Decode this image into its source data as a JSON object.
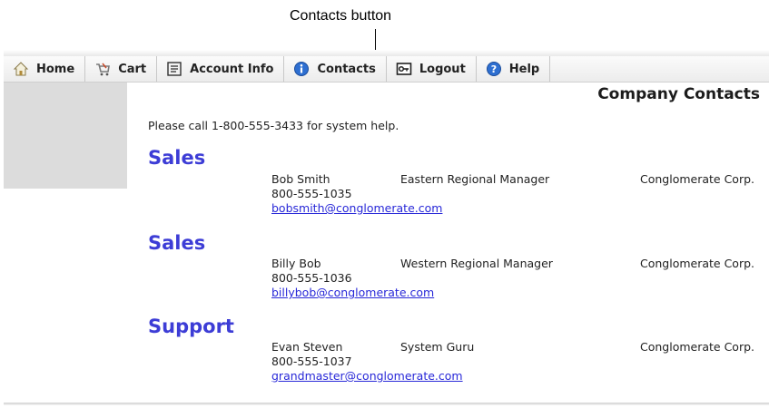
{
  "callout": {
    "text": "Contacts button"
  },
  "nav": {
    "items": [
      {
        "label": "Home",
        "icon": "home-icon"
      },
      {
        "label": "Cart",
        "icon": "cart-icon"
      },
      {
        "label": "Account Info",
        "icon": "account-info-icon"
      },
      {
        "label": "Contacts",
        "icon": "info-icon"
      },
      {
        "label": "Logout",
        "icon": "logout-icon"
      },
      {
        "label": "Help",
        "icon": "help-icon"
      }
    ]
  },
  "page": {
    "title": "Company Contacts",
    "help_text": "Please call 1-800-555-3433 for system help."
  },
  "sections": [
    {
      "heading": "Sales",
      "name": "Bob Smith",
      "role": "Eastern Regional Manager",
      "company": "Conglomerate Corp.",
      "phone": "800-555-1035",
      "email": "bobsmith@conglomerate.com"
    },
    {
      "heading": "Sales",
      "name": "Billy Bob",
      "role": "Western Regional Manager",
      "company": "Conglomerate Corp.",
      "phone": "800-555-1036",
      "email": "billybob@conglomerate.com"
    },
    {
      "heading": "Support",
      "name": "Evan Steven",
      "role": "System Guru",
      "company": "Conglomerate Corp.",
      "phone": "800-555-1037",
      "email": "grandmaster@conglomerate.com"
    }
  ],
  "colors": {
    "accent_heading": "#3d3dd6",
    "link": "#2828d8",
    "info_icon": "#2e6fd1"
  }
}
